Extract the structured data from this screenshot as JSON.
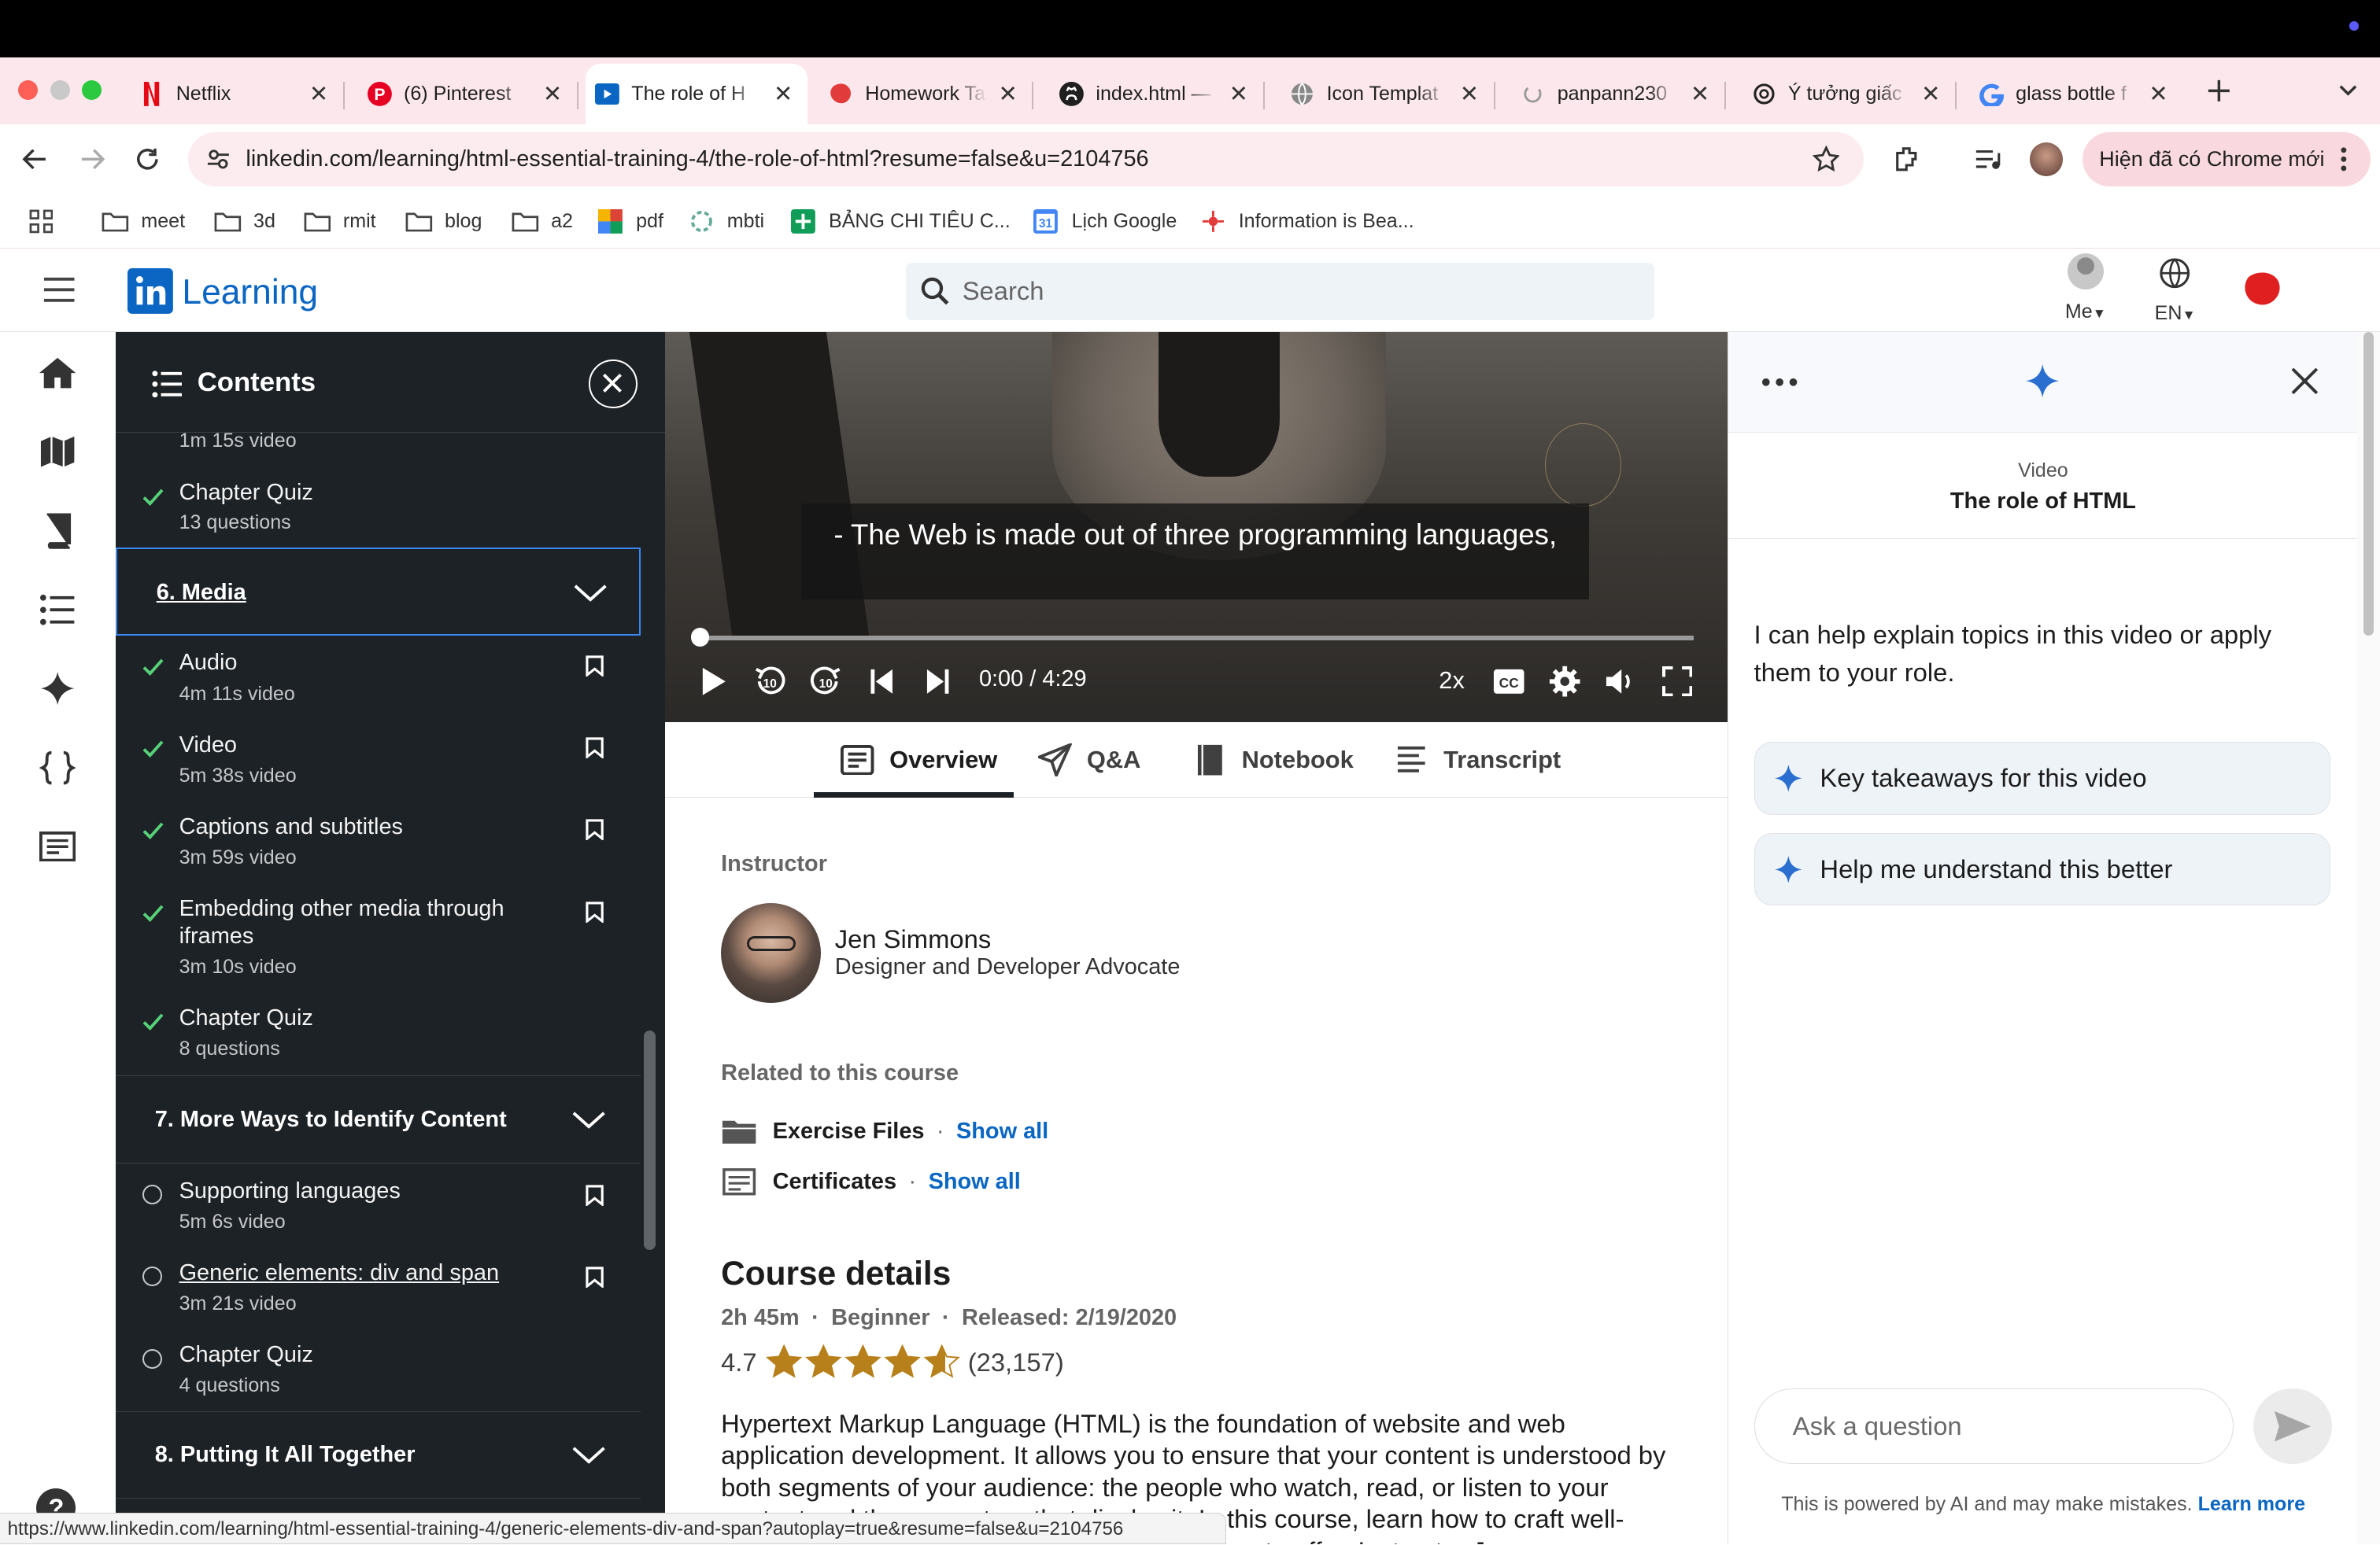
{
  "browser": {
    "tabs": [
      {
        "title": "Netflix",
        "icon": "netflix-icon"
      },
      {
        "title": "(6) Pinterest",
        "icon": "pinterest-icon"
      },
      {
        "title": "The role of H",
        "icon": "linkedin-learning-icon",
        "active": true
      },
      {
        "title": "Homework Ta",
        "icon": "red-blob-icon"
      },
      {
        "title": "index.html —",
        "icon": "github-icon"
      },
      {
        "title": "Icon Templat",
        "icon": "globe-icon"
      },
      {
        "title": "panpann230",
        "icon": "spinner-icon"
      },
      {
        "title": "Ý tưởng giấc",
        "icon": "openai-icon"
      },
      {
        "title": "glass bottle f",
        "icon": "google-icon"
      }
    ],
    "url": "linkedin.com/learning/html-essential-training-4/the-role-of-html?resume=false&u=2104756",
    "chrome_update": "Hiện đã có Chrome mới",
    "bookmarks": [
      "meet",
      "3d",
      "rmit",
      "blog",
      "a2",
      "pdf",
      "mbti",
      "BẢNG CHI TIÊU C...",
      "Lịch Google",
      "Information is Bea..."
    ],
    "status_url": "https://www.linkedin.com/learning/html-essential-training-4/generic-elements-div-and-span?autoplay=true&resume=false&u=2104756"
  },
  "header": {
    "logo_text": "Learning",
    "search_placeholder": "Search",
    "me_label": "Me",
    "lang_label": "EN"
  },
  "contents": {
    "title": "Contents",
    "top_partial": "1m 15s video",
    "quiz_prev": {
      "title": "Chapter Quiz",
      "sub": "13 questions"
    },
    "chapter6": {
      "title": "6. Media",
      "items": [
        {
          "title": "Audio",
          "sub": "4m 11s video"
        },
        {
          "title": "Video",
          "sub": "5m 38s video"
        },
        {
          "title": "Captions and subtitles",
          "sub": "3m 59s video"
        },
        {
          "title": "Embedding other media through iframes",
          "sub": "3m 10s video"
        },
        {
          "title": "Chapter Quiz",
          "sub": "8 questions"
        }
      ]
    },
    "chapter7": {
      "title": "7. More Ways to Identify Content",
      "items": [
        {
          "title": "Supporting languages",
          "sub": "5m 6s video"
        },
        {
          "title": "Generic elements: div and span",
          "sub": "3m 21s video"
        },
        {
          "title": "Chapter Quiz",
          "sub": "4 questions"
        }
      ]
    },
    "chapter8": {
      "title": "8. Putting It All Together"
    }
  },
  "video": {
    "caption": "- The Web is made out of three programming languages,",
    "time": "0:00 / 4:29",
    "speed": "2x",
    "progress": 0
  },
  "tabs": {
    "overview": "Overview",
    "qa": "Q&A",
    "notebook": "Notebook",
    "transcript": "Transcript"
  },
  "overview": {
    "instructor_label": "Instructor",
    "instructor_name": "Jen Simmons",
    "instructor_title": "Designer and Developer Advocate",
    "related_label": "Related to this course",
    "exercise_files": "Exercise Files",
    "certificates": "Certificates",
    "show_all": "Show all",
    "course_details": "Course details",
    "duration": "2h 45m",
    "level": "Beginner",
    "released": "Released: 2/19/2020",
    "rating": "4.7",
    "rating_count": "(23,157)",
    "description": "Hypertext Markup Language (HTML) is the foundation of website and web application development. It allows you to ensure that your content is understood by both segments of your audience: the people who watch, read, or listen to your content and the computers that display it. In this course, learn how to craft well-structured HTML and see what HTML itself has to offer. Instructor Jen"
  },
  "ai_panel": {
    "kind": "Video",
    "title": "The role of HTML",
    "intro": "I can help explain topics in this video or apply them to your role.",
    "suggestions": [
      "Key takeaways for this video",
      "Help me understand this better"
    ],
    "ask_placeholder": "Ask a question",
    "disclaimer": "This is powered by AI and may make mistakes.",
    "learn_more": "Learn more"
  },
  "colors": {
    "brand": "#0a66c2",
    "ai_accent": "#2a6ed0",
    "check": "#57d178",
    "sidebar": "#1d2226"
  }
}
